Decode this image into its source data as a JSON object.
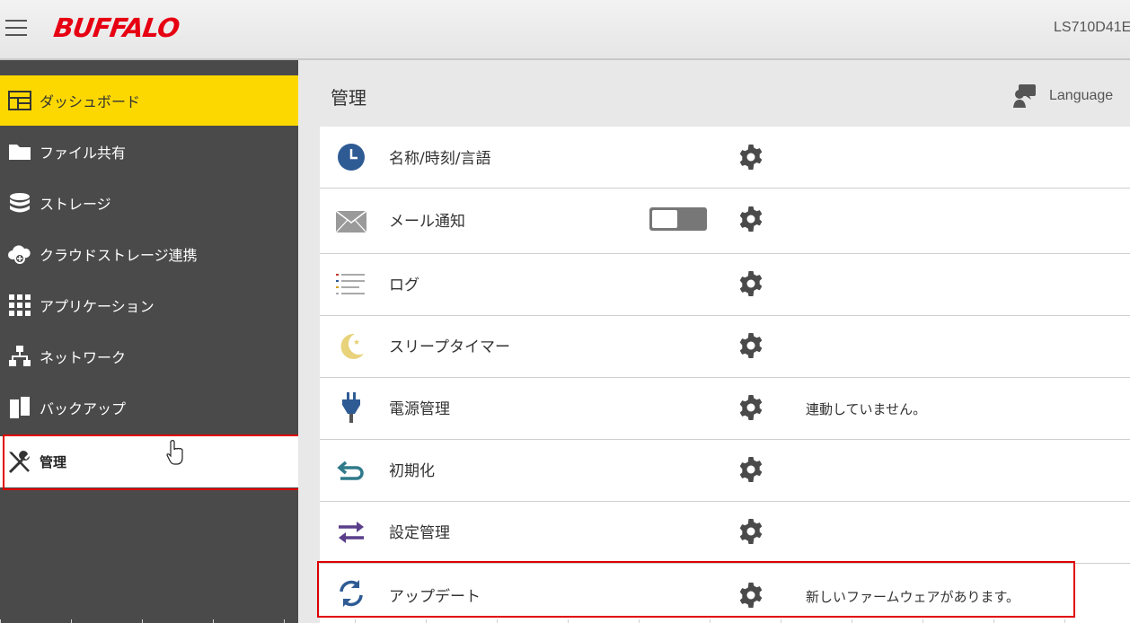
{
  "header": {
    "logo": "BUFFALO",
    "device_name": "LS710D41E"
  },
  "sidebar": {
    "items": [
      {
        "label": "ダッシュボード",
        "icon": "dashboard-icon"
      },
      {
        "label": "ファイル共有",
        "icon": "folder-icon"
      },
      {
        "label": "ストレージ",
        "icon": "storage-icon"
      },
      {
        "label": "クラウドストレージ連携",
        "icon": "cloud-icon"
      },
      {
        "label": "アプリケーション",
        "icon": "grid-icon"
      },
      {
        "label": "ネットワーク",
        "icon": "network-icon"
      },
      {
        "label": "バックアップ",
        "icon": "backup-icon"
      },
      {
        "label": "管理",
        "icon": "tools-icon"
      }
    ]
  },
  "main": {
    "title": "管理",
    "language_label": "Language",
    "rows": [
      {
        "label": "名称/時刻/言語",
        "icon": "clock-icon",
        "status": ""
      },
      {
        "label": "メール通知",
        "icon": "mail-icon",
        "status": "",
        "toggle": "off"
      },
      {
        "label": "ログ",
        "icon": "log-icon",
        "status": ""
      },
      {
        "label": "スリープタイマー",
        "icon": "moon-icon",
        "status": ""
      },
      {
        "label": "電源管理",
        "icon": "plug-icon",
        "status": "連動していません。"
      },
      {
        "label": "初期化",
        "icon": "return-icon",
        "status": ""
      },
      {
        "label": "設定管理",
        "icon": "transfer-icon",
        "status": ""
      },
      {
        "label": "アップデート",
        "icon": "refresh-icon",
        "status": "新しいファームウェアがあります。"
      }
    ]
  },
  "colors": {
    "accent_yellow": "#fcd800",
    "sidebar_bg": "#4a4a4a",
    "highlight_red": "#e00000",
    "brand_red": "#e60012"
  }
}
